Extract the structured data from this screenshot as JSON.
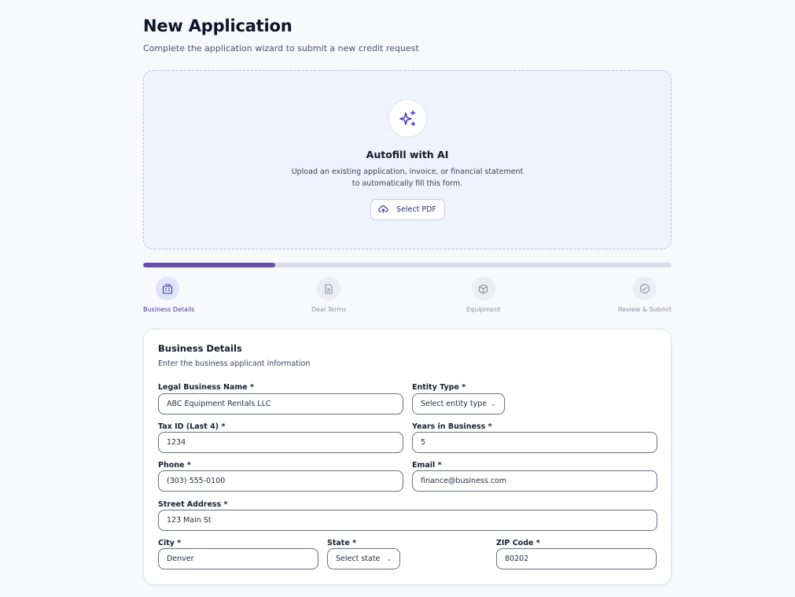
{
  "header": {
    "title": "New Application",
    "subtitle": "Complete the application wizard to submit a new credit request"
  },
  "autofill": {
    "icon": "sparkles-icon",
    "title": "Autofill with AI",
    "description_line1": "Upload an existing application, invoice, or financial statement",
    "description_line2": "to automatically fill this form.",
    "button_label": "Select PDF",
    "button_icon": "cloud-upload-icon"
  },
  "progress": {
    "value_percent": 25,
    "fill_color": "#6a4fa8"
  },
  "steps": [
    {
      "label": "Business Details",
      "icon": "building-icon",
      "active": true
    },
    {
      "label": "Deal Terms",
      "icon": "document-icon",
      "active": false
    },
    {
      "label": "Equipment",
      "icon": "package-icon",
      "active": false
    },
    {
      "label": "Review & Submit",
      "icon": "check-circle-icon",
      "active": false
    }
  ],
  "form": {
    "title": "Business Details",
    "description": "Enter the business applicant information",
    "legal_name": {
      "label": "Legal Business Name *",
      "value": "ABC Equipment Rentals LLC"
    },
    "entity_type": {
      "label": "Entity Type *",
      "value": "Select entity type"
    },
    "tax_id": {
      "label": "Tax ID (Last 4) *",
      "value": "1234"
    },
    "years": {
      "label": "Years in Business *",
      "value": "5"
    },
    "phone": {
      "label": "Phone *",
      "value": "(303) 555-0100"
    },
    "email": {
      "label": "Email *",
      "value": "finance@business.com"
    },
    "street": {
      "label": "Street Address *",
      "value": "123 Main St"
    },
    "city": {
      "label": "City *",
      "value": "Denver"
    },
    "state": {
      "label": "State *",
      "value": "Select state"
    },
    "zip": {
      "label": "ZIP Code *",
      "value": "80202"
    }
  }
}
